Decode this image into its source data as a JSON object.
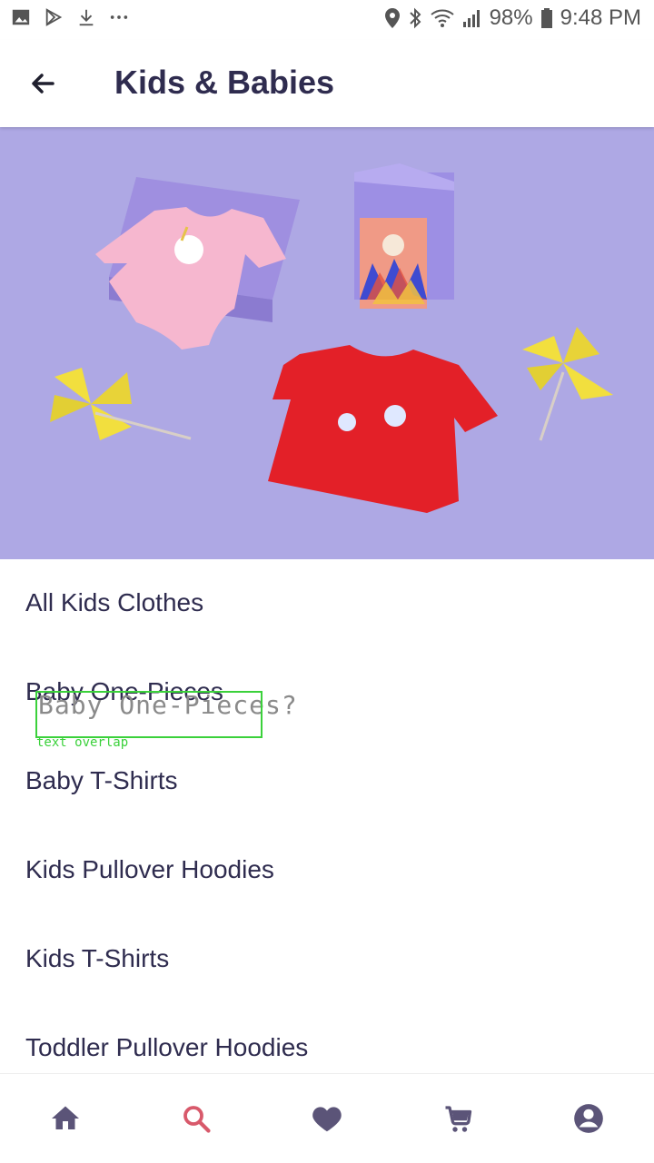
{
  "status_bar": {
    "battery": "98%",
    "time": "9:48 PM",
    "left_icons": [
      "image-icon",
      "play-store-icon",
      "download-icon",
      "more-icon"
    ],
    "right_icons": [
      "location-icon",
      "bluetooth-icon",
      "wifi-icon",
      "signal-icon",
      "battery-icon"
    ]
  },
  "header": {
    "title": "Kids & Babies",
    "back_icon": "arrow-left-icon"
  },
  "categories": [
    "All Kids Clothes",
    "Baby One-Pieces",
    "Baby T-Shirts",
    "Kids Pullover Hoodies",
    "Kids T-Shirts",
    "Toddler Pullover Hoodies"
  ],
  "overlay": {
    "text": "Baby One-Pieces?",
    "tag": "text overlap"
  },
  "bottom_nav": {
    "items": [
      "home-icon",
      "search-icon",
      "heart-icon",
      "cart-icon",
      "account-icon"
    ],
    "active": "search-icon",
    "accent": "#d8596b",
    "icon_color": "#5b5478"
  },
  "colors": {
    "title": "#2f2c4f",
    "hero_bg": "#aea8e4"
  }
}
